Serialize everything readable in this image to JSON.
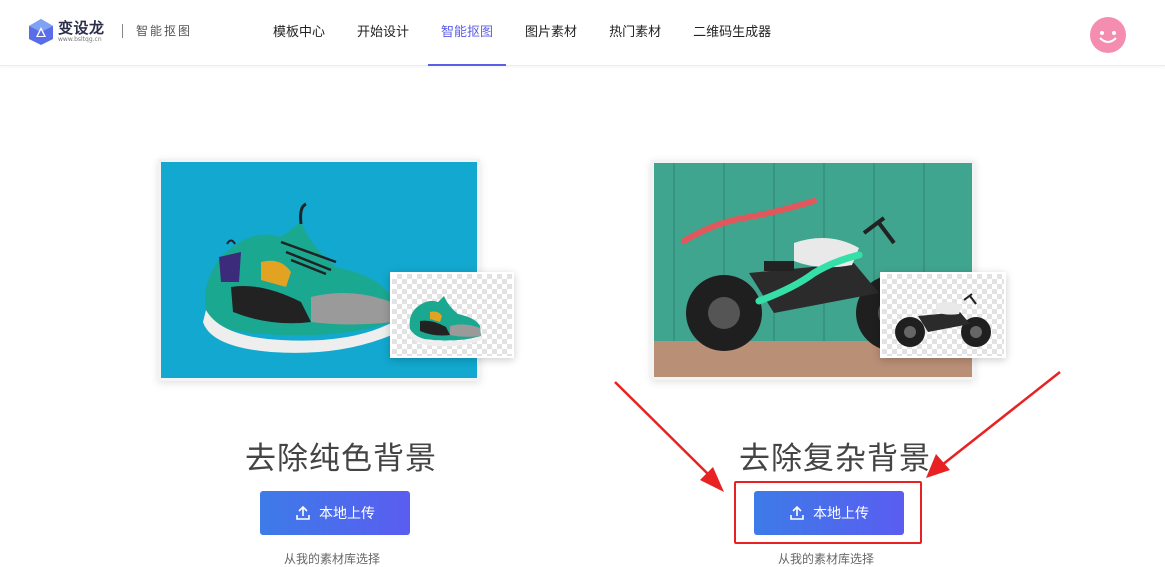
{
  "header": {
    "logo_name": "变设龙",
    "logo_url": "www.bsltqg.cn",
    "logo_subtitle": "智能抠图",
    "nav": [
      {
        "label": "模板中心",
        "active": false
      },
      {
        "label": "开始设计",
        "active": false
      },
      {
        "label": "智能抠图",
        "active": true
      },
      {
        "label": "图片素材",
        "active": false
      },
      {
        "label": "热门素材",
        "active": false
      },
      {
        "label": "二维码生成器",
        "active": false
      }
    ],
    "avatar_icon": "smiley-avatar"
  },
  "cards": [
    {
      "title": "去除纯色背景",
      "upload_label": "本地上传",
      "library_link": "从我的素材库选择",
      "image": "sneaker-on-blue"
    },
    {
      "title": "去除复杂背景",
      "upload_label": "本地上传",
      "library_link": "从我的素材库选择",
      "image": "motorcycle-on-green-wall"
    }
  ],
  "colors": {
    "accent": "#5b5ee6",
    "button_start": "#3d7be8",
    "button_end": "#5a5df0",
    "annotation": "#e82222"
  }
}
